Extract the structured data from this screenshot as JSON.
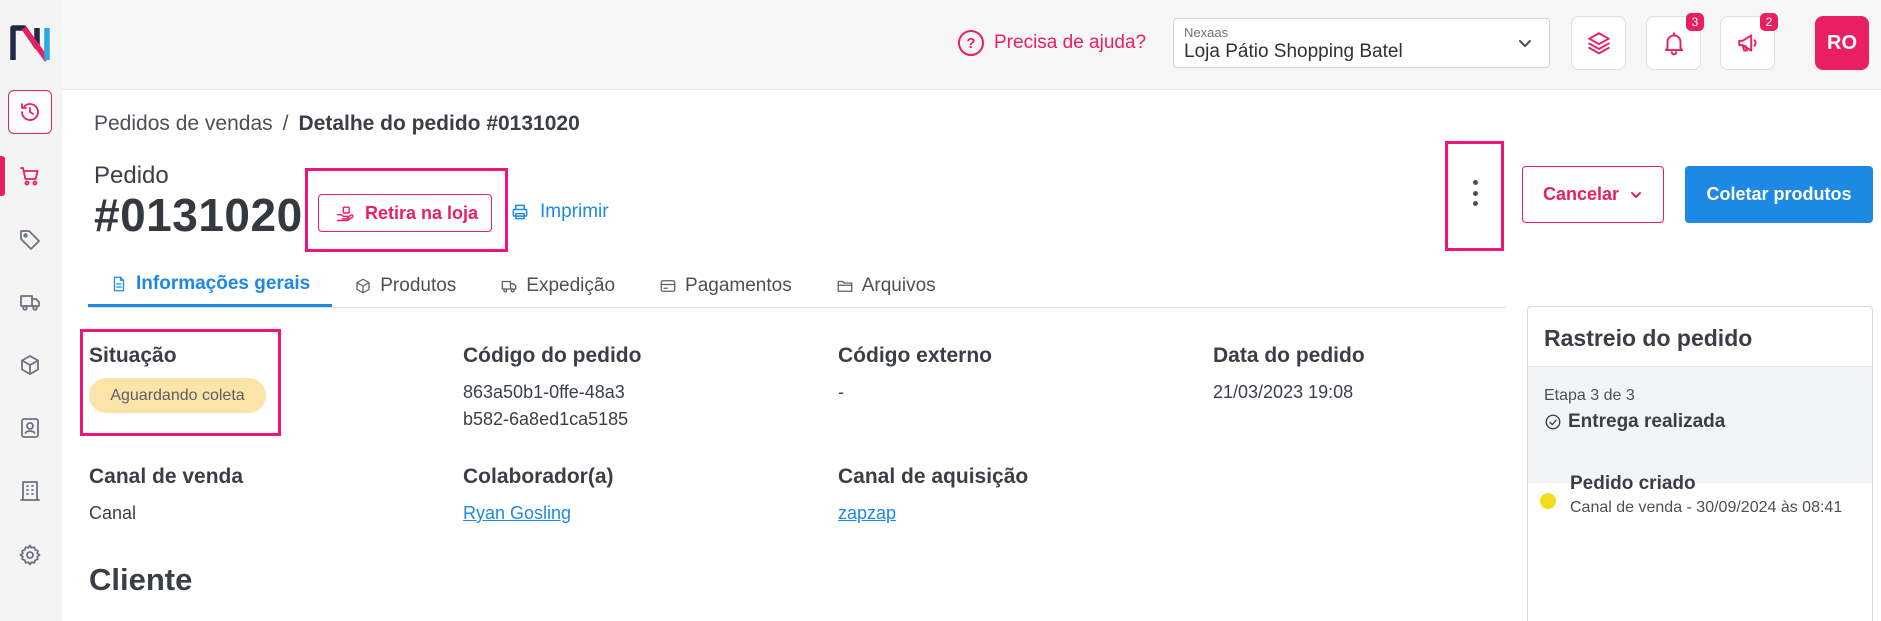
{
  "header": {
    "help_label": "Precisa de ajuda?",
    "help_icon": "?",
    "store_label": "Nexaas",
    "store_value": "Loja Pátio Shopping Batel",
    "notifications_count": "3",
    "announcements_count": "2",
    "avatar_initials": "RO"
  },
  "breadcrumb": {
    "parent": "Pedidos de vendas",
    "separator": "/",
    "current": "Detalhe do pedido #0131020"
  },
  "order": {
    "label": "Pedido",
    "number": "#0131020",
    "pickup_label": "Retira na loja",
    "print_label": "Imprimir",
    "cancel_label": "Cancelar",
    "collect_label": "Coletar produtos"
  },
  "tabs": [
    {
      "label": "Informações gerais",
      "active": true
    },
    {
      "label": "Produtos"
    },
    {
      "label": "Expedição"
    },
    {
      "label": "Pagamentos"
    },
    {
      "label": "Arquivos"
    }
  ],
  "fields": {
    "situacao_label": "Situação",
    "situacao_value": "Aguardando coleta",
    "codigo_label": "Código do pedido",
    "codigo_line1": "863a50b1-0ffe-48a3",
    "codigo_line2": "b582-6a8ed1ca5185",
    "externo_label": "Código externo",
    "externo_value": "-",
    "data_label": "Data do pedido",
    "data_value": "21/03/2023 19:08",
    "canal_label": "Canal de venda",
    "canal_value": "Canal",
    "colab_label": "Colaborador(a)",
    "colab_value": "Ryan Gosling",
    "aquis_label": "Canal de aquisição",
    "aquis_value": "zapzap"
  },
  "client_section_title": "Cliente",
  "tracking": {
    "title": "Rastreio do pedido",
    "step_counter": "Etapa 3 de 3",
    "step_name": "Entrega realizada",
    "events": [
      {
        "title": "Pedido criado",
        "subtitle": "Canal de venda - 30/09/2024 às 08:41",
        "dot_color": "#f2dd1c"
      }
    ]
  },
  "colors": {
    "accent": "#e91e63",
    "primary": "#1e88e5",
    "highlight": "#f0157a",
    "status_bg": "#fce3a8"
  }
}
